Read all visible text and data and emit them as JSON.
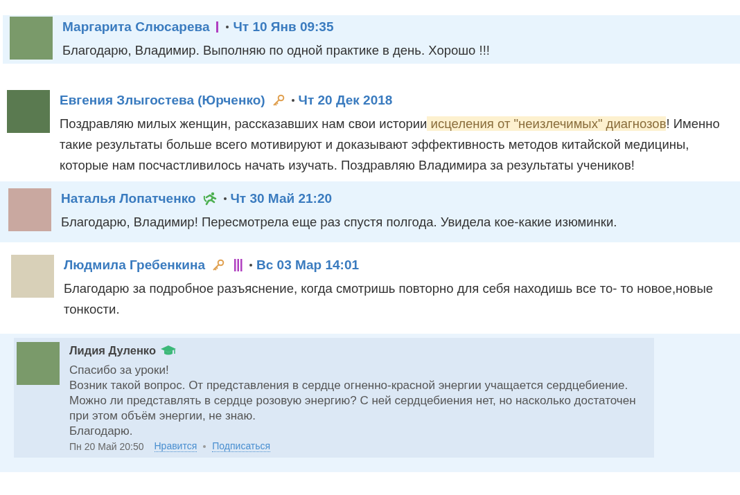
{
  "comments": [
    {
      "kind": "comment",
      "highlighted": true,
      "author": "Маргарита Слюсарева",
      "badges": [
        {
          "kind": "bar",
          "color": "#b040c0"
        }
      ],
      "date": "Чт 10 Янв 09:35",
      "text_parts": [
        {
          "text": "Благодарю, Владимир. Выполняю по одной практике в день. Хорошо !!!",
          "highlighted": false
        }
      ]
    },
    {
      "kind": "comment",
      "highlighted": false,
      "author": "Евгения Злыгостева (Юрченко)",
      "badges": [
        {
          "kind": "key",
          "color": "#e0a050"
        }
      ],
      "date": "Чт 20 Дек 2018",
      "text_parts": [
        {
          "text": "Поздравляю милых женщин, рассказавших нам свои истории",
          "highlighted": false
        },
        {
          "text": " исцеления от \"неизлечимых\" диагнозов",
          "highlighted": true
        },
        {
          "text": "! Именно такие результаты больше всего мотивируют и доказывают эффективность методов китайской медицины, которые нам посчастливилось начать изучать. Поздравляю Владимира за результаты учеников!",
          "highlighted": false
        }
      ]
    },
    {
      "kind": "comment",
      "highlighted": true,
      "author": "Наталья Лопатченко",
      "badges": [
        {
          "kind": "runner",
          "color": "#4caf50"
        }
      ],
      "date": "Чт 30 Май 21:20",
      "text_parts": [
        {
          "text": "Благодарю, Владимир! Пересмотрела еще раз спустя полгода. Увидела кое-какие изюминки.",
          "highlighted": false
        }
      ]
    },
    {
      "kind": "comment",
      "highlighted": false,
      "author": "Людмила Гребенкина",
      "badges": [
        {
          "kind": "key",
          "color": "#e0a050"
        },
        {
          "kind": "bars",
          "color": "#b040c0"
        }
      ],
      "date": "Вс 03 Мар 14:01",
      "text_parts": [
        {
          "text": "Благодарю за подробное разъяснение, когда смотришь повторно для себя находишь все то- то новое,новые тонкости.",
          "highlighted": false
        }
      ]
    },
    {
      "kind": "reply",
      "highlighted": true,
      "author": "Лидия Дуленко",
      "badges": [
        {
          "kind": "cap",
          "color": "#3cb878"
        }
      ],
      "date": "Пн 20 Май 20:50",
      "lines": [
        "Спасибо за уроки!",
        "Возник такой вопрос. От представления в сердце огненно-красной энергии учащается сердцебиение.",
        "Можно ли представлять в сердце розовую энергию? С ней сердцебиения нет, но насколько достаточен",
        "при этом объём энергии, не знаю.",
        "Благодарю."
      ],
      "actions": [
        "Нравится",
        "Подписаться"
      ]
    }
  ]
}
